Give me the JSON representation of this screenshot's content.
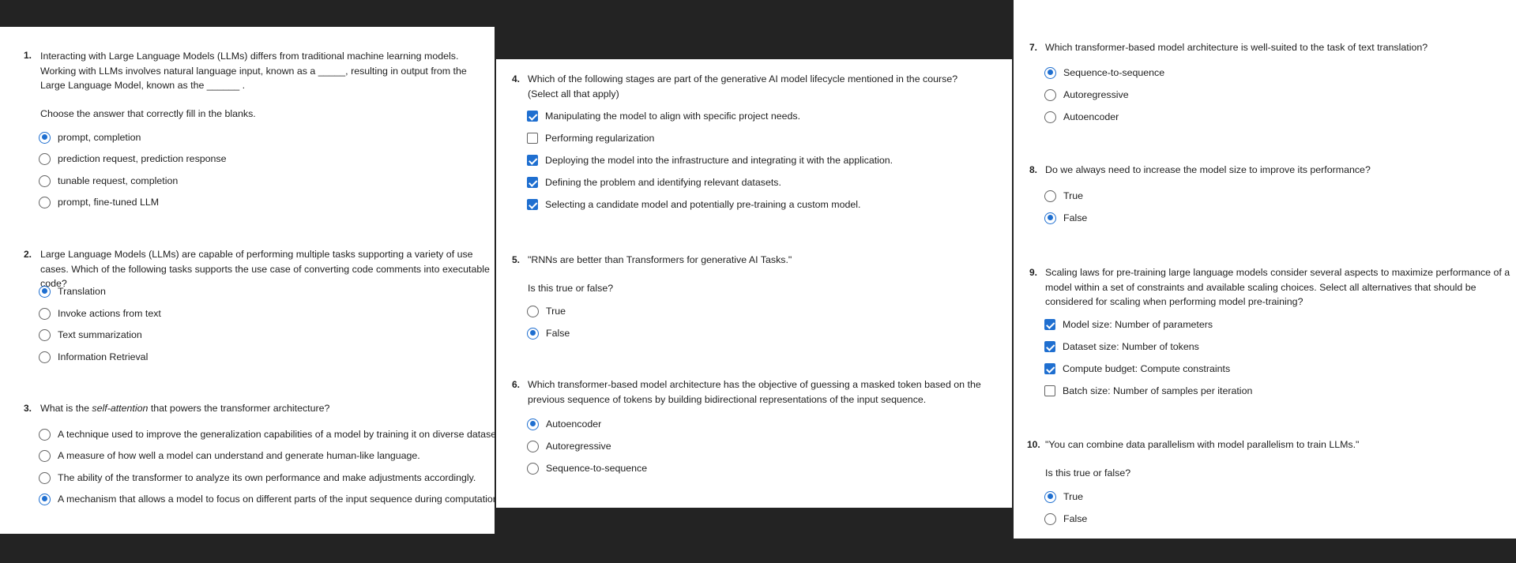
{
  "colors": {
    "accent": "#1f6fd0",
    "panel": "#ffffff",
    "backdrop": "#232323"
  },
  "q1": {
    "num": "1.",
    "text": "Interacting with Large Language Models (LLMs) differs from traditional machine learning models.  Working with LLMs involves natural language input, known as a  _____, resulting in output from the Large Language Model, known as the ______ .",
    "sub": "Choose the answer that correctly fill in the blanks.",
    "options": [
      "prompt, completion",
      " prediction request, prediction response",
      "tunable request, completion",
      "prompt, fine-tuned LLM"
    ],
    "selected": 0
  },
  "q2": {
    "num": "2.",
    "text": "Large Language Models (LLMs) are capable of performing multiple tasks supporting a variety of use cases.  Which of the following tasks supports the use case of converting code comments into executable code?",
    "options": [
      "Translation",
      "Invoke actions from text",
      "Text summarization",
      "Information Retrieval"
    ],
    "selected": 0
  },
  "q3": {
    "num": "3.",
    "text_before": "What is the ",
    "text_em": "self-attention",
    "text_after": " that powers the transformer architecture?",
    "options": [
      "A technique used to improve the generalization capabilities of a model by training it on diverse datasets.",
      "A measure of how well a model can understand and generate human-like language.",
      "The ability of the transformer to analyze its own performance and make adjustments accordingly.",
      "A mechanism that allows a model to focus on different parts of the input sequence during computation."
    ],
    "selected": 3
  },
  "q4": {
    "num": "4.",
    "text": "Which of the following stages are part of the generative AI model lifecycle mentioned in the course? (Select all that apply)",
    "options": [
      "Manipulating the model to align with specific project needs.",
      "Performing regularization",
      "Deploying the model into the infrastructure and integrating it with the application.",
      "Defining the problem and identifying relevant datasets.",
      "Selecting a candidate model and potentially pre-training a custom model."
    ],
    "checked": [
      true,
      false,
      true,
      true,
      true
    ]
  },
  "q5": {
    "num": "5.",
    "text": "\"RNNs are better than Transformers for generative AI Tasks.\"",
    "sub": "Is this true or false?",
    "options": [
      "True",
      "False"
    ],
    "selected": 1
  },
  "q6": {
    "num": "6.",
    "text": "Which transformer-based model architecture has the objective of guessing a masked token based on the previous sequence of tokens by building bidirectional representations of the input sequence.",
    "options": [
      "Autoencoder",
      "Autoregressive",
      "Sequence-to-sequence"
    ],
    "selected": 0
  },
  "q7": {
    "num": "7.",
    "text": "Which transformer-based model architecture is well-suited to the task of text translation?",
    "options": [
      "Sequence-to-sequence",
      "Autoregressive",
      "Autoencoder"
    ],
    "selected": 0
  },
  "q8": {
    "num": "8.",
    "text": "Do we always need to increase the model size to improve its performance?",
    "options": [
      "True",
      "False"
    ],
    "selected": 1
  },
  "q9": {
    "num": "9.",
    "text": "Scaling laws for pre-training large language models consider several aspects to maximize performance of a model within a set of constraints and available scaling choices.  Select all alternatives that should be considered for scaling when performing model pre-training?",
    "options": [
      "Model size: Number of parameters",
      "Dataset size: Number of tokens",
      "Compute budget: Compute constraints",
      "Batch size: Number of samples per iteration"
    ],
    "checked": [
      true,
      true,
      true,
      false
    ]
  },
  "q10": {
    "num": "10.",
    "text": "\"You can combine data parallelism with model parallelism to train LLMs.\"",
    "sub": "Is this true or false?",
    "options": [
      "True",
      "False"
    ],
    "selected": 0
  }
}
